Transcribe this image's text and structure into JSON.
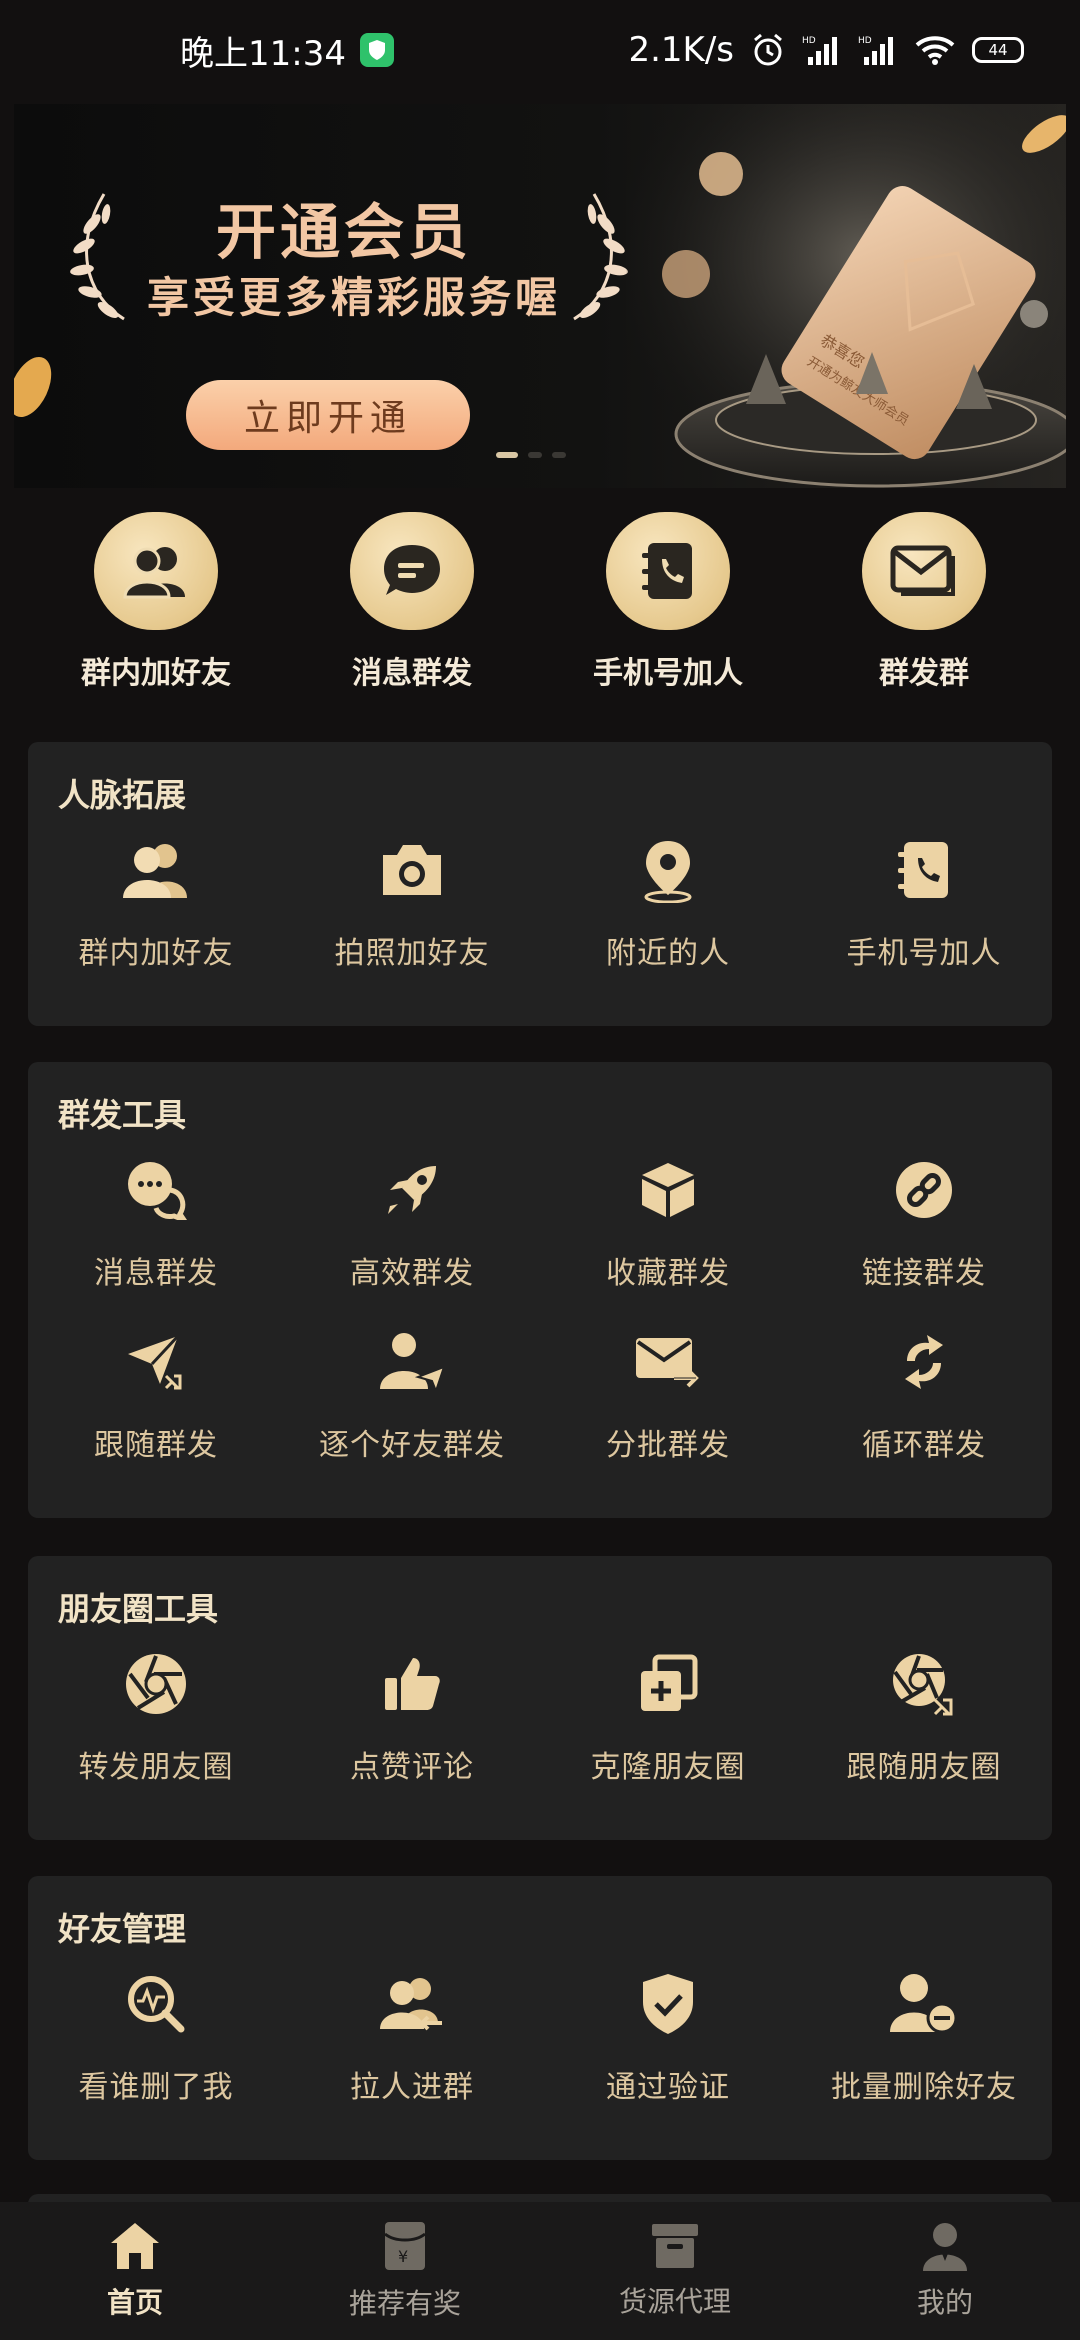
{
  "status": {
    "time": "晚上11:34",
    "net_speed": "2.1K/s",
    "battery": "44"
  },
  "banner": {
    "title": "开通会员",
    "subtitle": "享受更多精彩服务喔",
    "button": "立即开通",
    "card_text_1": "恭喜您",
    "card_text_2": "开通为鲸友大师会员"
  },
  "quick": [
    {
      "label": "群内加好友",
      "icon": "contacts-icon"
    },
    {
      "label": "消息群发",
      "icon": "chat-icon"
    },
    {
      "label": "手机号加人",
      "icon": "phone-book-icon"
    },
    {
      "label": "群发群",
      "icon": "mail-icon"
    }
  ],
  "sections": [
    {
      "title": "人脉拓展",
      "items": [
        {
          "label": "群内加好友"
        },
        {
          "label": "拍照加好友"
        },
        {
          "label": "附近的人"
        },
        {
          "label": "手机号加人"
        }
      ]
    },
    {
      "title": "群发工具",
      "items": [
        {
          "label": "消息群发"
        },
        {
          "label": "高效群发"
        },
        {
          "label": "收藏群发"
        },
        {
          "label": "链接群发"
        },
        {
          "label": "跟随群发"
        },
        {
          "label": "逐个好友群发"
        },
        {
          "label": "分批群发"
        },
        {
          "label": "循环群发"
        }
      ]
    },
    {
      "title": "朋友圈工具",
      "items": [
        {
          "label": "转发朋友圈"
        },
        {
          "label": "点赞评论"
        },
        {
          "label": "克隆朋友圈"
        },
        {
          "label": "跟随朋友圈"
        }
      ]
    },
    {
      "title": "好友管理",
      "items": [
        {
          "label": "看谁删了我"
        },
        {
          "label": "拉人进群"
        },
        {
          "label": "通过验证"
        },
        {
          "label": "批量删除好友"
        }
      ]
    }
  ],
  "nav": [
    {
      "label": "首页"
    },
    {
      "label": "推荐有奖"
    },
    {
      "label": "货源代理"
    },
    {
      "label": "我的"
    }
  ],
  "colors": {
    "background": "#121010",
    "card": "#222222",
    "gold": "#e8cf9c",
    "accent_button": "#f3a97c"
  }
}
